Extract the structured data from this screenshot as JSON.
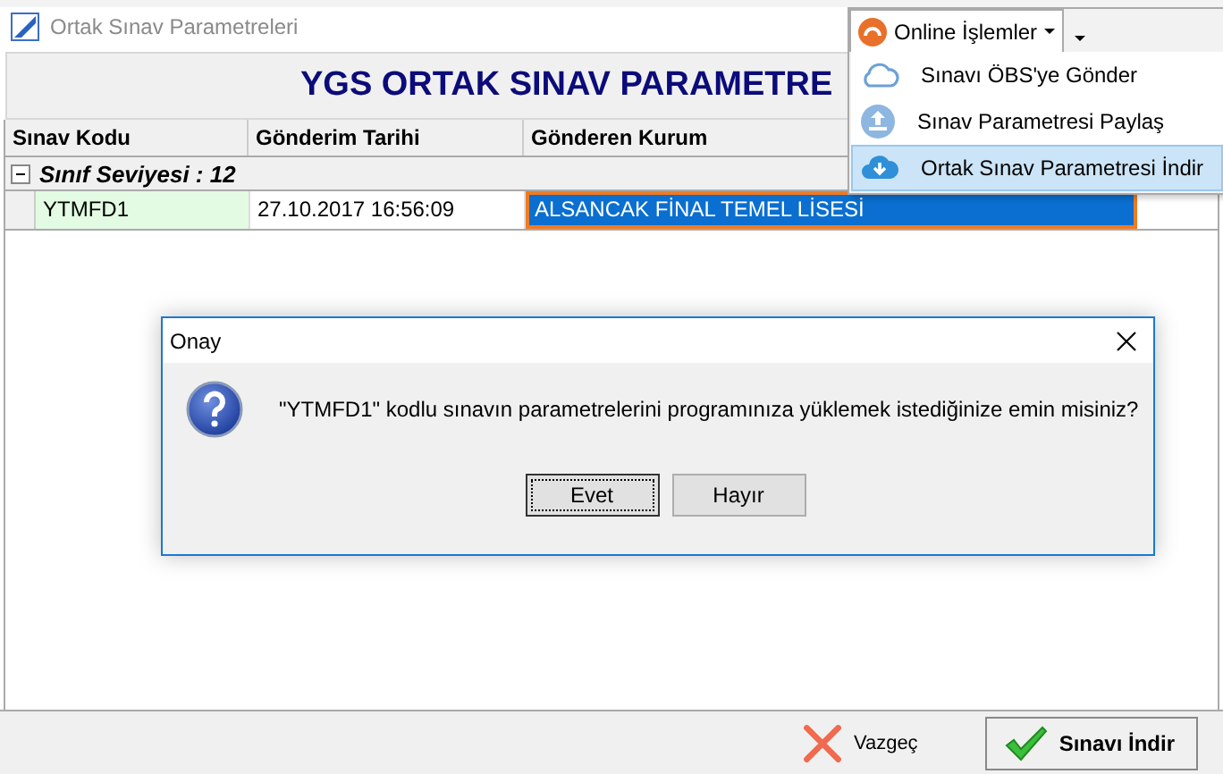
{
  "window": {
    "title": "Ortak Sınav Parametreleri"
  },
  "header": {
    "title": "YGS ORTAK SINAV PARAMETRE"
  },
  "table": {
    "columns": [
      "Sınav Kodu",
      "Gönderim Tarihi",
      "Gönderen Kurum"
    ],
    "groups": [
      {
        "label": "Sınıf Seviyesi : 12",
        "expanded": true,
        "rows": [
          {
            "cells": [
              "YTMFD1",
              "27.10.2017 16:56:09",
              "ALSANCAK FİNAL TEMEL LİSESİ"
            ],
            "selected": true
          }
        ]
      }
    ]
  },
  "footer": {
    "buttons": [
      {
        "label": "Vazgeç",
        "kind": "cancel"
      },
      {
        "label": "Sınavı İndir",
        "kind": "confirm"
      }
    ]
  },
  "menu": {
    "label": "Online İşlemler",
    "items": [
      {
        "label": "Sınavı ÖBS'ye Gönder",
        "kind": "cloud",
        "selected": false
      },
      {
        "label": "Sınav Parametresi Paylaş",
        "kind": "share",
        "selected": false
      },
      {
        "label": "Ortak Sınav Parametresi İndir",
        "kind": "download",
        "selected": true
      }
    ]
  },
  "dialog": {
    "title": "Onay",
    "message": "\"YTMFD1\" kodlu sınavın parametrelerini programınıza yüklemek istediğinize emin misiniz?",
    "buttons": [
      {
        "label": "Evet",
        "selected": true
      },
      {
        "label": "Hayır",
        "selected": false
      }
    ]
  }
}
